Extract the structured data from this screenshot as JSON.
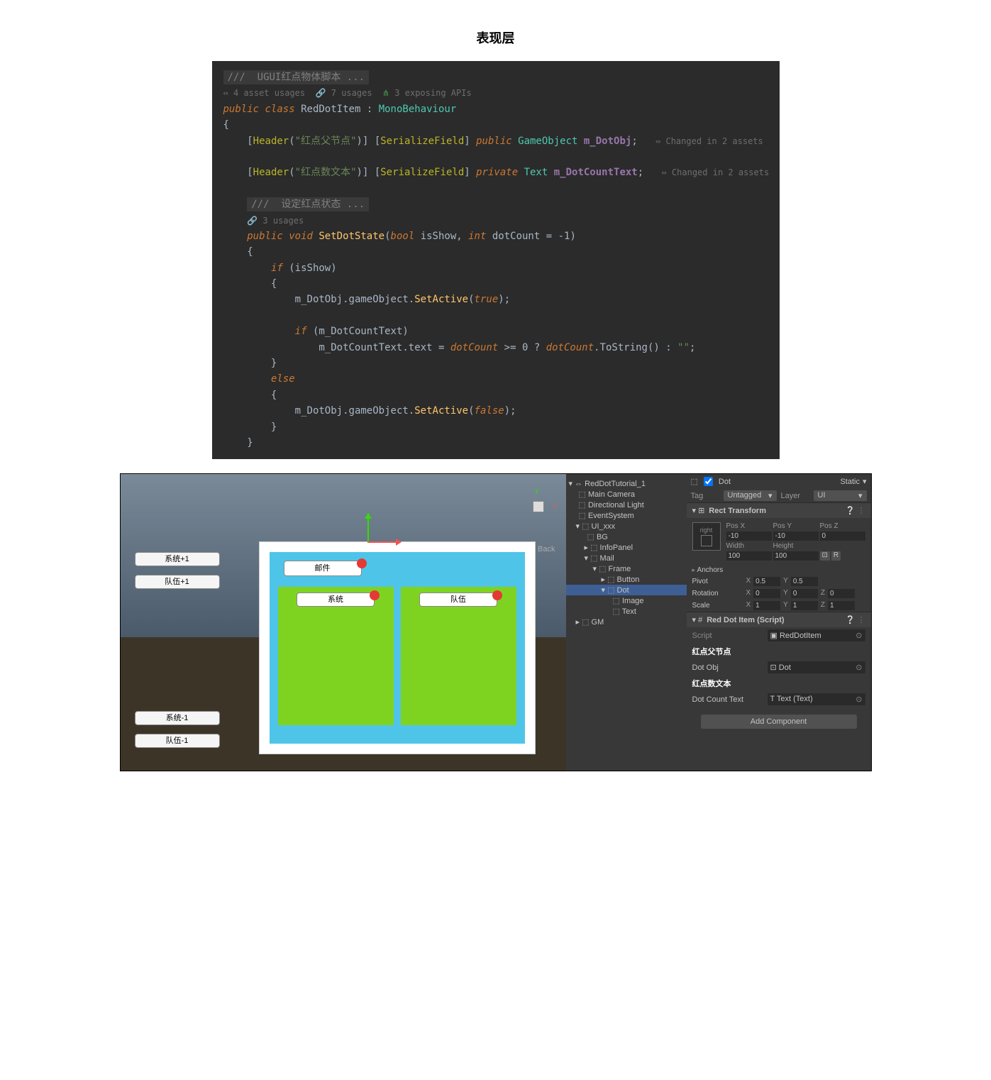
{
  "page_title": "表现层",
  "code": {
    "comment1": "///  UGUI红点物体脚本 ...",
    "hints": {
      "asset_usages": "4 asset usages",
      "usages": "7 usages",
      "apis": "3 exposing APIs",
      "method_usages": "3 usages"
    },
    "class_decl": {
      "modifier": "public class",
      "name": "RedDotItem",
      "base": "MonoBehaviour"
    },
    "field1": {
      "header_attr": "Header",
      "header_val": "\"红点父节点\"",
      "serialize": "SerializeField",
      "modifier": "public",
      "type": "GameObject",
      "name": "m_DotObj",
      "changed": "Changed in 2 assets"
    },
    "field2": {
      "header_attr": "Header",
      "header_val": "\"红点数文本\"",
      "serialize": "SerializeField",
      "modifier": "private",
      "type": "Text",
      "name": "m_DotCountText",
      "changed": "Changed in 2 assets"
    },
    "comment2": "///  设定红点状态 ...",
    "method": {
      "modifier": "public void",
      "name": "SetDotState",
      "p1type": "bool",
      "p1": "isShow",
      "p2type": "int",
      "p2": "dotCount",
      "default": "-1"
    },
    "body": {
      "if_kw": "if",
      "else_kw": "else",
      "line1_a": "m_DotObj",
      "line1_b": ".gameObject.",
      "line1_c": "SetActive",
      "line1_true": "true",
      "if2_var": "m_DotCountText",
      "line2_a": "m_DotCountText",
      "line2_b": ".text = ",
      "line2_c": "dotCount",
      "line2_d": " >= 0 ? ",
      "line2_e": "dotCount",
      "line2_f": ".ToString",
      "line2_g": "() : ",
      "line2_h": "\"\"",
      "line3_a": "m_DotObj",
      "line3_b": ".gameObject.",
      "line3_c": "SetActive",
      "line3_false": "false"
    }
  },
  "scene": {
    "buttons_top": [
      "系统+1",
      "队伍+1"
    ],
    "buttons_bottom": [
      "系统-1",
      "队伍-1"
    ],
    "back_label": "≡ Back",
    "mail_btn": "邮件",
    "system_btn": "系统",
    "team_btn": "队伍"
  },
  "hierarchy": {
    "root": "RedDotTutorial_1",
    "items": [
      "Main Camera",
      "Directional Light",
      "EventSystem"
    ],
    "ui": "UI_xxx",
    "ui_children": [
      "BG",
      "InfoPanel"
    ],
    "mail": "Mail",
    "frame": "Frame",
    "frame_children": [
      "Button"
    ],
    "dot": "Dot",
    "dot_children": [
      "Image",
      "Text"
    ],
    "gm": "GM"
  },
  "inspector": {
    "object_name": "Dot",
    "static_label": "Static",
    "tag_label": "Tag",
    "tag_value": "Untagged",
    "layer_label": "Layer",
    "layer_value": "UI",
    "rect_title": "Rect Transform",
    "anchor_preset": {
      "h": "right",
      "v": "top"
    },
    "pos": {
      "x_label": "Pos X",
      "y_label": "Pos Y",
      "z_label": "Pos Z",
      "x": "-10",
      "y": "-10",
      "z": "0"
    },
    "size": {
      "w_label": "Width",
      "h_label": "Height",
      "w": "100",
      "h": "100"
    },
    "anchors_label": "Anchors",
    "pivot": {
      "label": "Pivot",
      "x": "0.5",
      "y": "0.5"
    },
    "rotation": {
      "label": "Rotation",
      "x": "0",
      "y": "0",
      "z": "0"
    },
    "scale": {
      "label": "Scale",
      "x": "1",
      "y": "1",
      "z": "1"
    },
    "script_comp": {
      "title": "Red Dot Item (Script)",
      "script_label": "Script",
      "script_value": "RedDotItem"
    },
    "header1": "红点父节点",
    "dot_obj": {
      "label": "Dot Obj",
      "value": "Dot"
    },
    "header2": "红点数文本",
    "dot_count": {
      "label": "Dot Count Text",
      "value": "Text (Text)"
    },
    "add_component": "Add Component"
  }
}
